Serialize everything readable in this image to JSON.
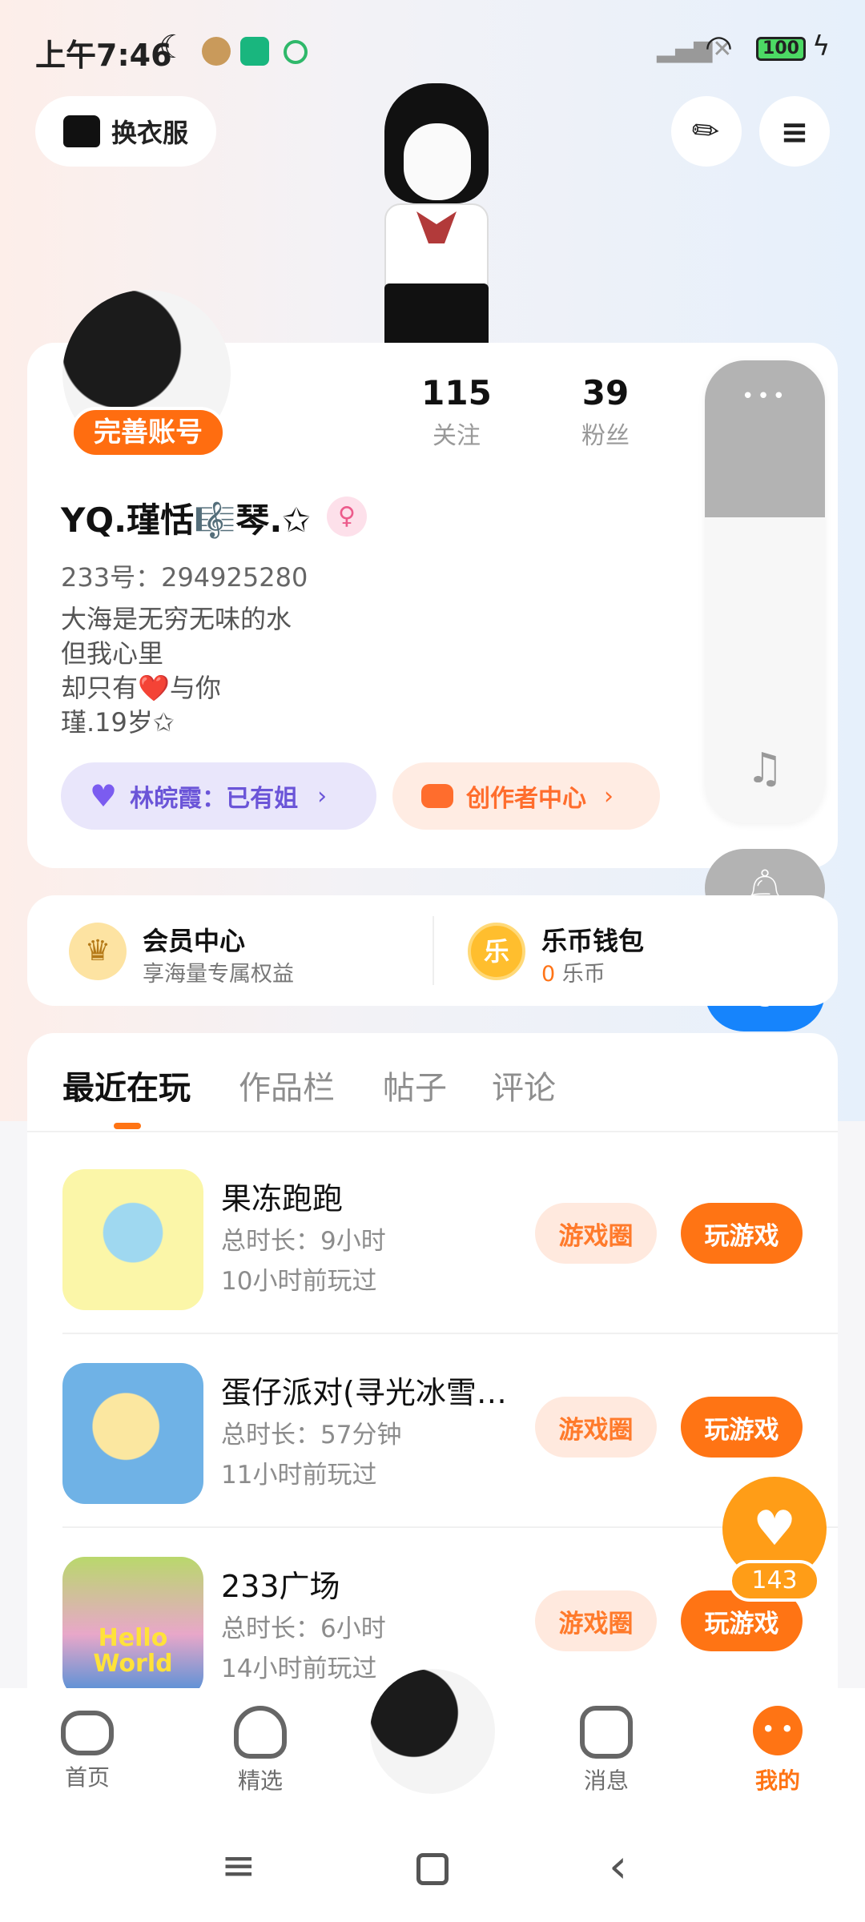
{
  "status_bar": {
    "time": "上午7:46",
    "battery": "100"
  },
  "header": {
    "wardrobe_label": "换衣服"
  },
  "profile": {
    "complete_badge": "完善账号",
    "following_count": "115",
    "following_label": "关注",
    "followers_count": "39",
    "followers_label": "粉丝",
    "nickname": "YQ.瑾恬🎼琴.✩",
    "id_line": "233号：294925280",
    "bio": [
      "大海是无穷无味的水",
      "但我心里",
      "却只有❤️与你",
      "瑾.19岁✩"
    ],
    "relation_label": "林皖霞：已有姐",
    "creator_label": "创作者中心"
  },
  "side_panel": {
    "more_dots": "•••"
  },
  "membership": {
    "vip_title": "会员中心",
    "vip_sub": "享海量专属权益",
    "coin_icon": "乐",
    "wallet_title": "乐币钱包",
    "wallet_amount": "0",
    "wallet_unit": "乐币"
  },
  "tabs": [
    "最近在玩",
    "作品栏",
    "帖子",
    "评论"
  ],
  "games": [
    {
      "title": "果冻跑跑",
      "duration": "总时长：9小时",
      "last_played": "10小时前玩过",
      "circle_btn": "游戏圈",
      "play_btn": "玩游戏"
    },
    {
      "title": "蛋仔派对(寻光冰雪…",
      "duration": "总时长：57分钟",
      "last_played": "11小时前玩过",
      "circle_btn": "游戏圈",
      "play_btn": "玩游戏"
    },
    {
      "title": "233广场",
      "duration": "总时长：6小时",
      "last_played": "14小时前玩过",
      "circle_btn": "游戏圈",
      "play_btn": "玩游戏"
    }
  ],
  "game3_art_text": "Hello World",
  "like_float": {
    "count": "143"
  },
  "bottom_nav": {
    "home": "首页",
    "featured": "精选",
    "messages": "消息",
    "mine": "我的"
  },
  "colors": {
    "accent": "#ff7414",
    "moon_button": "#1684fc"
  }
}
